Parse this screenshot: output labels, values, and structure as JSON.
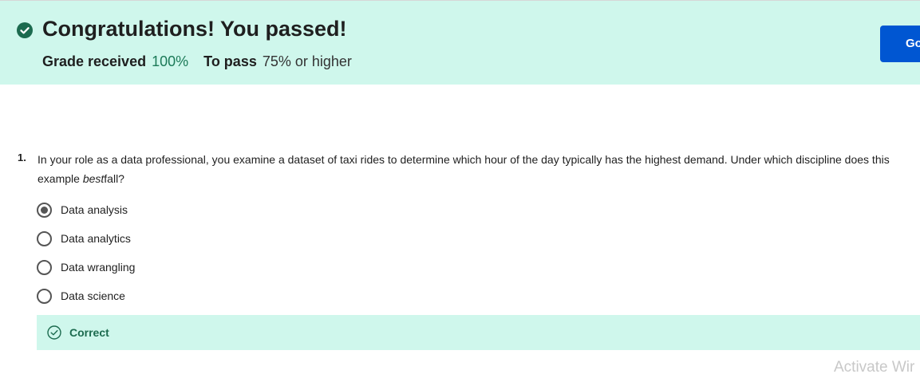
{
  "banner": {
    "title": "Congratulations! You passed!",
    "grade_label": "Grade received",
    "grade_value": "100%",
    "pass_label": "To pass",
    "pass_value": "75% or higher",
    "go_button_label": "Go",
    "icon": "check-circle-icon",
    "background_color": "#cff7ec",
    "accent_color": "#1c7a58"
  },
  "question": {
    "number": "1.",
    "text_before": "In your role as a data professional, you examine a dataset of taxi rides to determine which hour of the day typically has the highest demand. Under which discipline does this example ",
    "text_emphasis": "best",
    "text_after": "fall?",
    "options": [
      {
        "label": "Data analysis",
        "selected": true
      },
      {
        "label": "Data analytics",
        "selected": false
      },
      {
        "label": "Data wrangling",
        "selected": false
      },
      {
        "label": "Data science",
        "selected": false
      }
    ]
  },
  "feedback": {
    "label": "Correct",
    "icon": "check-circle-outline-icon",
    "color": "#1c6b4f"
  },
  "watermark": {
    "text": "Activate Wir"
  }
}
